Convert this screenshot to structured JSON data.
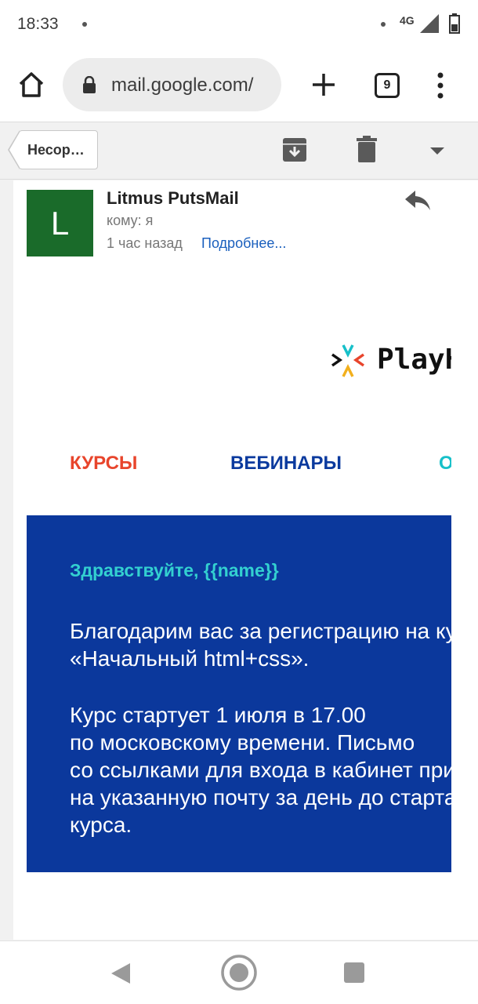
{
  "status_bar": {
    "time": "18:33",
    "network": "4G"
  },
  "browser": {
    "url": "mail.google.com/",
    "tab_count": "9"
  },
  "gmail_bar": {
    "back_label": "Несор…"
  },
  "message": {
    "avatar_letter": "L",
    "sender": "Litmus PutsMail",
    "recipient": "кому: я",
    "time": "1 час назад",
    "details_link": "Подробнее..."
  },
  "email_content": {
    "brand": "PlayHelp",
    "nav": {
      "courses": "КУРСЫ",
      "webinars": "ВЕБИНАРЫ",
      "other": "О НАС"
    },
    "greeting": "Здравствуйте, {{name}}",
    "paragraph1": [
      "Благодарим вас за регистрацию на курс",
      "«Начальный html+css»."
    ],
    "paragraph2": [
      "Курс стартует 1 июля в 17.00",
      "по московскому времени. Письмо",
      "со ссылками для входа в кабинет придёт",
      "на указанную почту за день до старта",
      "курса."
    ]
  },
  "colors": {
    "avatar": "#1a6b2a",
    "promo_bg": "#0b389c",
    "accent_red": "#e8452c",
    "accent_blue": "#0b3a9e",
    "accent_teal": "#17c0c9",
    "link": "#1a5fbd"
  },
  "icons": [
    "home-icon",
    "lock-icon",
    "plus-icon",
    "tabs-icon",
    "menu-icon",
    "archive-icon",
    "delete-icon",
    "reply-icon",
    "back-icon",
    "home-button-icon",
    "recent-icon"
  ]
}
